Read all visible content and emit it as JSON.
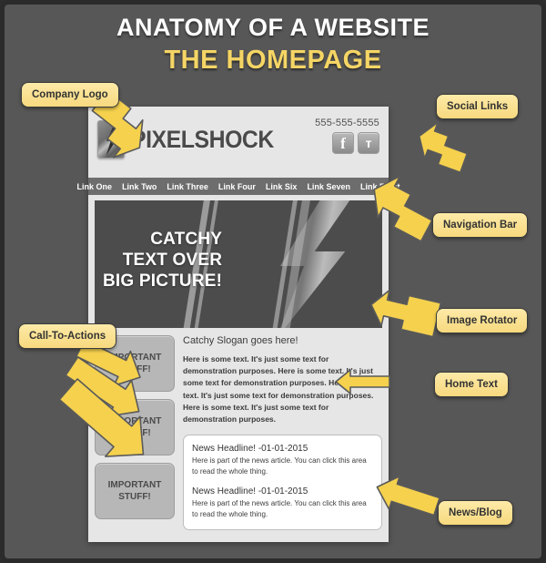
{
  "title": {
    "line1": "ANATOMY OF A WEBSITE",
    "line2": "THE HOMEPAGE"
  },
  "colors": {
    "background": "#575757",
    "callout_fill": "#f7d97e",
    "callout_border": "#3b3b3b",
    "arrow_fill": "#f5d14e",
    "title_accent": "#f5d565",
    "page_bg": "#e6e6e6",
    "nav_bar": "#6d6d6d",
    "cta_box": "#b7b7b7"
  },
  "site": {
    "logo": {
      "icon": "lightning-bolt-logo",
      "wordmark": "PIXELSHOCK"
    },
    "phone": "555-555-5555",
    "social": [
      {
        "name": "facebook-icon",
        "glyph": "f"
      },
      {
        "name": "twitter-icon",
        "glyph": "т"
      }
    ],
    "nav_links": [
      "Link One",
      "Link Two",
      "Link Three",
      "Link Four",
      "Link Six",
      "Link Seven",
      "Link Eight"
    ],
    "hero": {
      "line1": "CATCHY",
      "line2": "TEXT OVER",
      "line3": "BIG PICTURE!"
    },
    "cta_boxes": [
      {
        "line1": "IMPORTANT",
        "line2": "STUFF!"
      },
      {
        "line1": "IMPORTANT",
        "line2": "STUFF!"
      },
      {
        "line1": "IMPORTANT",
        "line2": "STUFF!"
      }
    ],
    "slogan": "Catchy Slogan goes here!",
    "body_copy": "Here is some text. It's just some text for demonstration purposes. Here is some text. It's just some text for demonstration purposes. Here is some text. It's just some text for demonstration purposes. Here is some text. It's just some text for demonstration purposes.",
    "news": [
      {
        "headline": "News Headline! -01-01-2015",
        "body": "Here is part of the news article. You can click this area to read the whole thing."
      },
      {
        "headline": "News Headline! -01-01-2015",
        "body": "Here is part of the news article. You can click this area to read the whole thing."
      }
    ]
  },
  "callouts": {
    "company_logo": "Company Logo",
    "social_links": "Social Links",
    "navigation_bar": "Navigation Bar",
    "image_rotator": "Image Rotator",
    "home_text": "Home Text",
    "news_blog": "News/Blog",
    "call_to_actions": "Call-To-Actions"
  }
}
